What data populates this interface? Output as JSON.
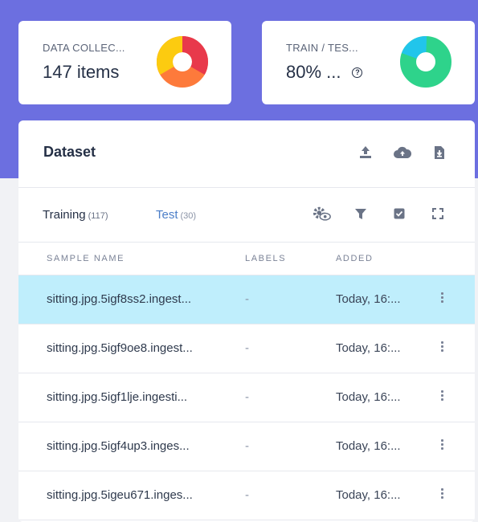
{
  "stats": {
    "data_collected": {
      "label": "DATA COLLEC...",
      "value": "147 items"
    },
    "train_test": {
      "label": "TRAIN / TES...",
      "value": "80% ..."
    }
  },
  "panel": {
    "title": "Dataset",
    "header_icons": [
      "upload-icon",
      "cloud-upload-icon",
      "download-icon"
    ]
  },
  "tabs": [
    {
      "label": "Training",
      "count": "(117)"
    },
    {
      "label": "Test",
      "count": "(30)"
    }
  ],
  "tab_icons": [
    "settings-view-icon",
    "filter-icon",
    "checkbox-icon",
    "fullscreen-icon"
  ],
  "columns": {
    "name": "SAMPLE NAME",
    "labels": "LABELS",
    "added": "ADDED"
  },
  "rows": [
    {
      "name": "sitting.jpg.5igf8ss2.ingest...",
      "labels": "-",
      "added": "Today, 16:..."
    },
    {
      "name": "sitting.jpg.5igf9oe8.ingest...",
      "labels": "-",
      "added": "Today, 16:..."
    },
    {
      "name": "sitting.jpg.5igf1lje.ingesti...",
      "labels": "-",
      "added": "Today, 16:..."
    },
    {
      "name": "sitting.jpg.5igf4up3.inges...",
      "labels": "-",
      "added": "Today, 16:..."
    },
    {
      "name": "sitting.jpg.5igeu671.inges...",
      "labels": "-",
      "added": "Today, 16:..."
    }
  ],
  "colors": {
    "accent": "#6c6fe0",
    "selected_row": "#bfeefc",
    "donut1": [
      "#fccb10",
      "#e8394b",
      "#fd7a3b"
    ],
    "donut2": [
      "#2ed38b",
      "#21c5eb"
    ]
  }
}
